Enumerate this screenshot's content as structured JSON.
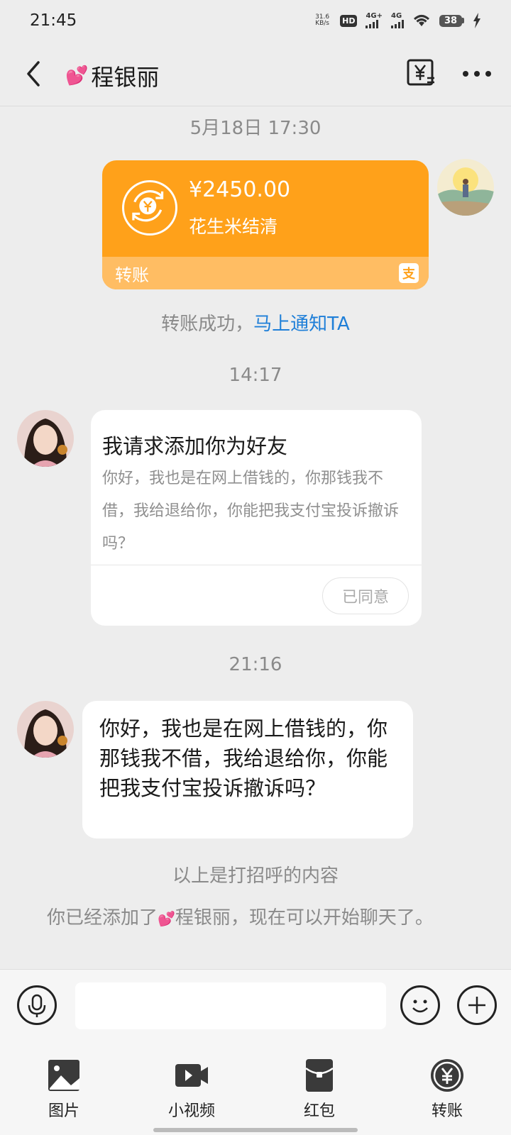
{
  "status_bar": {
    "time": "21:45",
    "speed_value": "31.6",
    "speed_unit": "KB/s",
    "hd_badge": "HD",
    "network_1": "4G+",
    "network_2": "4G",
    "battery": "38"
  },
  "header": {
    "title": "程银丽",
    "title_emoji": "💕"
  },
  "chat": {
    "timestamp_1": "5月18日 17:30",
    "transfer": {
      "amount": "¥2450.00",
      "description": "花生米结清",
      "label": "转账",
      "logo_text": "支"
    },
    "transfer_notice_prefix": "转账成功，",
    "transfer_notice_link": "马上通知TA",
    "timestamp_2": "14:17",
    "friend_request": {
      "title": "我请求添加你为好友",
      "body": "你好，我也是在网上借钱的，你那钱我不借，我给退给你，你能把我支付宝投诉撤诉吗？",
      "button": "已同意"
    },
    "timestamp_3": "21:16",
    "message": "你好，我也是在网上借钱的，你那钱我不借，我给退给你，你能把我支付宝投诉撤诉吗？",
    "greeting_notice": "以上是打招呼的内容",
    "added_notice_prefix": "你已经添加了",
    "added_notice_emoji": "💕",
    "added_notice_suffix": "程银丽，现在可以开始聊天了。"
  },
  "input": {
    "placeholder": ""
  },
  "tools": [
    {
      "label": "图片",
      "icon": "image-icon"
    },
    {
      "label": "小视频",
      "icon": "video-icon"
    },
    {
      "label": "红包",
      "icon": "red-packet-icon"
    },
    {
      "label": "转账",
      "icon": "transfer-icon"
    }
  ],
  "colors": {
    "transfer_orange": "#ffa11a",
    "transfer_footer": "#ffbd63",
    "link_blue": "#1f7fd8",
    "background": "#ededed"
  }
}
